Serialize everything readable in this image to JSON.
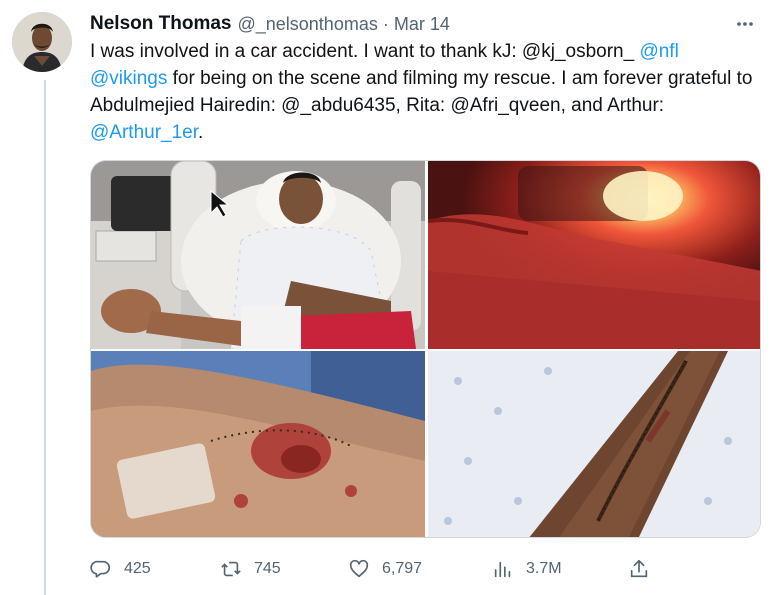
{
  "tweet": {
    "author_name": "Nelson Thomas",
    "author_handle": "@_nelsonthomas",
    "separator": "·",
    "date": "Mar 14",
    "text_parts": [
      "I was involved in a car accident. I want to thank kJ: @kj_osborn_ ",
      "@nfl",
      "\n",
      "@vikings",
      " for being on the scene and filming my rescue. I am forever grateful to Abdulmejied Hairedin: @_abdu6435, Rita: @Afri_qveen, and Arthur: ",
      "@Arthur_1er",
      "."
    ],
    "media_count": 4
  },
  "icons": {
    "more": "more-options-icon",
    "reply": "reply-icon",
    "retweet": "retweet-icon",
    "like": "like-icon",
    "views": "views-icon",
    "share": "share-icon"
  },
  "stats": {
    "replies": "425",
    "retweets": "745",
    "likes": "6,797",
    "views": "3.7M"
  },
  "colors": {
    "link": "#1d9bf0",
    "text": "#0f1419",
    "secondary": "#536471",
    "divider": "#cfd9de"
  }
}
